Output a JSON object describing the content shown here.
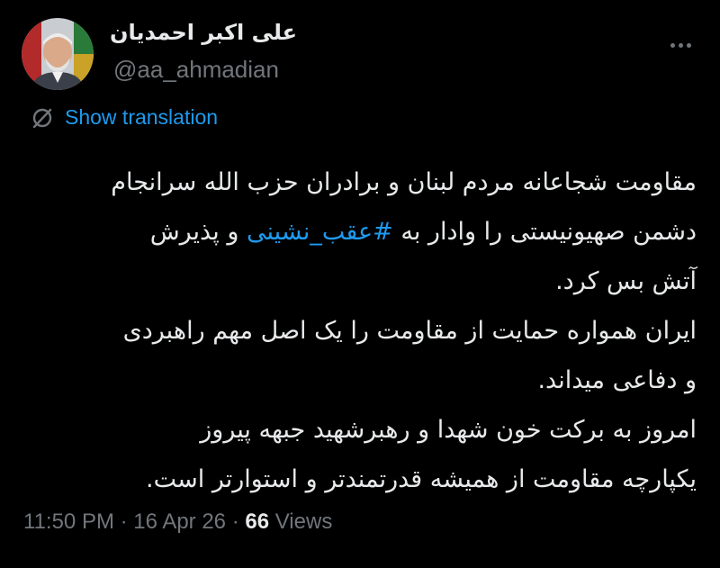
{
  "author": {
    "display_name": "علی اکبر احمدیان",
    "handle": "@aa_ahmadian"
  },
  "icons": {
    "avatar": "profile-photo",
    "more": "more-options-icon",
    "translate": "globe-icon"
  },
  "translate": {
    "label": "Show translation"
  },
  "tweet": {
    "line1": "مقاومت شجاعانه مردم لبنان و برادران حزب الله سرانجام",
    "line2_before": "دشمن صهیونیستی را وادار به ",
    "hashtag": "#عقب_نشینی",
    "line2_after": " و پذیرش",
    "line3": "آتش بس کرد.",
    "line4": "ایران همواره حمایت از مقاومت را یک اصل مهم راهبردی",
    "line5": "و دفاعی میداند.",
    "line6": "امروز به برکت خون شهدا و رهبرشهید جبهه پیروز",
    "line7": "یکپارچه مقاومت از همیشه قدرتمندتر و استوارتر است."
  },
  "meta": {
    "time": "11:50 PM",
    "separator": " · ",
    "date": "16 Apr 26",
    "views_count": "66",
    "views_label": " Views"
  },
  "colors": {
    "background": "#000000",
    "text": "#e7e9ea",
    "secondary": "#71767b",
    "accent": "#1d9bf0"
  }
}
